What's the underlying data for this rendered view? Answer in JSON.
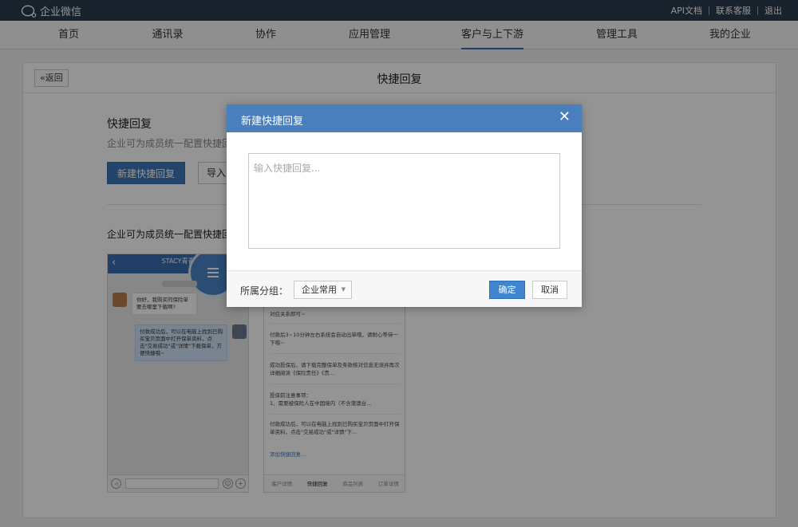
{
  "topbar": {
    "logo_text": "企业微信",
    "links": [
      "API文档",
      "联系客服",
      "退出"
    ]
  },
  "nav": {
    "items": [
      "首页",
      "通讯录",
      "协作",
      "应用管理",
      "客户与上下游",
      "管理工具",
      "我的企业"
    ],
    "active": "客户与上下游"
  },
  "panel": {
    "back_label": "返回",
    "title": "快捷回复",
    "section_title": "快捷回复",
    "section_desc": "企业可为成员统一配置快捷回",
    "new_button": "新建快捷回复",
    "import_button": "导入",
    "demo_label": "企业可为成员统一配置快捷回复"
  },
  "phone1": {
    "header_name": "STACY青青",
    "bubble_left": "你好，我购买的保险单要去哪里下载啊?",
    "bubble_right": "付款成功后，可以在电脑上找到已购买宝贝页面中打开保单资料，点击\"交易成功\"或\"详情\"下载保单，方便快捷哦~"
  },
  "phone2": {
    "items": [
      "对应关系即可~",
      "付款后3~10分钟左右系统会自动出单哦，请耐心等待一下哦~",
      "成功投保后，请下载完整保单及条款核对信息无误并再次详细阅读《保险责任》《责...",
      "投保前注意事项：\n1、需要被保险人在中国境内（不含港澳台...",
      "付款成功后，可以在电脑上找到已购买宝贝页面中打开保单资料，点击\"交易成功\"或\"详情\"下..."
    ],
    "add_link": "添加快捷回复...",
    "tabs": [
      "客户详情",
      "快捷回复",
      "商品列表",
      "订单详情"
    ],
    "active_tab": "快捷回复"
  },
  "dialog": {
    "title": "新建快捷回复",
    "textarea_placeholder": "输入快捷回复...",
    "group_label": "所属分组：",
    "group_value": "企业常用",
    "ok_label": "确定",
    "cancel_label": "取消"
  },
  "colors": {
    "topbar_bg": "#2a3b4f",
    "dialog_header": "#4a7fbd",
    "primary_button": "#3f78b8",
    "ok_button": "#3f85cf"
  }
}
